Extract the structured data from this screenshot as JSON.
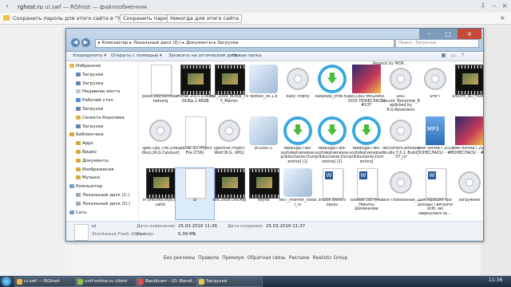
{
  "browser": {
    "url_host": "rghost.ru",
    "url_rest": "ui.swf — RGhost — файлообменник",
    "password_bar": {
      "text": "Сохранить пароль для этого сайта в \"Yandex\"?",
      "save_label": "Сохранить пароль",
      "never_label": "Никогда для этого сайта"
    }
  },
  "explorer": {
    "breadcrumb": "▸ Компьютер ▸ Локальный диск (D:) ▸ Документы ▸ Загрузки",
    "search_placeholder": "Поиск: Загрузки",
    "toolbar": {
      "organize": "Упорядочить ▾",
      "open_with": "Открыть с помощью ▾",
      "burn": "Записать на оптический диск",
      "new_folder": "Новая папка"
    },
    "tree": [
      {
        "label": "Избранное",
        "color": "#e8b84a",
        "indent": 0
      },
      {
        "label": "Загрузки",
        "color": "#5d86b3",
        "indent": 1
      },
      {
        "label": "Загрузки",
        "color": "#5d86b3",
        "indent": 1
      },
      {
        "label": "Недавние места",
        "color": "#b8c7d8",
        "indent": 1
      },
      {
        "label": "Рабочий стол",
        "color": "#4a8fd0",
        "indent": 1
      },
      {
        "label": "Загрузки",
        "color": "#5d86b3",
        "indent": 1
      },
      {
        "label": "Сюжета Королева",
        "color": "#d8b24a",
        "indent": 1
      },
      {
        "label": "Загрузки",
        "color": "#5d86b3",
        "indent": 1
      },
      {
        "label": "Библиотеки",
        "color": "#d7a842",
        "indent": 0
      },
      {
        "label": "Apps",
        "color": "#d7a842",
        "indent": 1
      },
      {
        "label": "Видео",
        "color": "#d7a842",
        "indent": 1
      },
      {
        "label": "Документы",
        "color": "#d7a842",
        "indent": 1
      },
      {
        "label": "Изображения",
        "color": "#d7a842",
        "indent": 1
      },
      {
        "label": "Музыка",
        "color": "#d7a842",
        "indent": 1
      },
      {
        "label": "Компьютер",
        "color": "#7aa0c8",
        "indent": 0
      },
      {
        "label": "Локальный диск (C:)",
        "color": "#9aa6b2",
        "indent": 1
      },
      {
        "label": "Локальный диск (D:)",
        "color": "#9aa6b2",
        "indent": 1
      },
      {
        "label": "Сеть",
        "color": "#7aa0c8",
        "indent": 0
      }
    ],
    "banner_text": "Repack by MOP...",
    "files": [
      {
        "name": "posle.dozhdichka.chetverg",
        "kind": "doc"
      },
      {
        "name": "Prizrak.2015.O.WEB-DLRip.1.46GB",
        "kind": "video"
      },
      {
        "name": "Put_2009_BDRip_745_Marren",
        "kind": "video"
      },
      {
        "name": "raidcall_v8.1.8",
        "kind": "app"
      },
      {
        "name": "Rally Trophy",
        "kind": "disc"
      },
      {
        "name": "Rasplata_[tfile.ru]",
        "kind": "dl"
      },
      {
        "name": "RECORD MEGAMIX 2015 ПОНЕСЛАСЬ! #137",
        "kind": "music"
      },
      {
        "name": "SAS-Secure_Tomorrow_Repacked by R.G.Revenants",
        "kind": "disc"
      },
      {
        "name": "SHIFT",
        "kind": "disc"
      },
      {
        "name": "Shturm_BD_HDRip",
        "kind": "video"
      },
      {
        "name": "Spec.Ops.The.Line.(Rus).[R.G.Catalyst]",
        "kind": "disc"
      },
      {
        "name": "Special 3D Project File (C56)",
        "kind": "doc"
      },
      {
        "name": "Spectraz Project Wolf [R.G. UPG]",
        "kind": "disc"
      },
      {
        "name": "st328971",
        "kind": "app"
      },
      {
        "name": "tabaluga-i-leo-vozhdestvenskoe-prikliuchenie-[torr entino] (1)",
        "kind": "dl"
      },
      {
        "name": "tabaluga-i-leo-vozhdestvenskoe-prikliuchenie-[torr entino] (2)",
        "kind": "dl"
      },
      {
        "name": "tabaluga-i-leo-vozhdestvenskoe-prikliuchenie-[torr entino]",
        "kind": "dl"
      },
      {
        "name": "TechSmithCamtasiaStudio.7.0.1_Build_57_ru",
        "kind": "disc"
      },
      {
        "name": "TRAP КАЧАЕТ 2015 ПОНЕСЛАСЬ! - #7",
        "kind": "mp3"
      },
      {
        "name": "TRAP КАЧАЕТ 2015 ПОНЕСЛАСЬ! - #11",
        "kind": "music"
      },
      {
        "name": "Tri.orechka.dlya.zolushki",
        "kind": "video"
      },
      {
        "name": "ui",
        "kind": "docsel"
      },
      {
        "name": "Volt.2008 DVDRip",
        "kind": "video"
      },
      {
        "name": "Voyna",
        "kind": "video"
      },
      {
        "name": "WoT_internet_install_ru",
        "kind": "app"
      },
      {
        "name": "zrazok blenkiv zayav",
        "kind": "word"
      },
      {
        "name": "Боевая система Никиты Шеменкова",
        "kind": "word"
      },
      {
        "name": "Все глобальные_2",
        "kind": "disc"
      },
      {
        "name": "Декларация про доходы і витрати осіб, які звернулися за ...",
        "kind": "word"
      },
      {
        "name": "загружено",
        "kind": "disc"
      }
    ],
    "details": {
      "name": "ui",
      "type": "Shockwave Flash Object",
      "modified_label": "Дата изменения:",
      "modified_value": "25.03.2016 11:36",
      "size_label": "Размер:",
      "size_value": "5,39 МБ",
      "created_label": "Дата создания:",
      "created_value": "25.03.2016 11:37"
    }
  },
  "footer": {
    "links": [
      "Без рекламы",
      "Правила",
      "Премиум",
      "Обратная связь",
      "Реклама",
      "Realistic Group"
    ]
  },
  "taskbar": {
    "items": [
      {
        "label": "ui.swf — RGhost",
        "color": "#e9b84a"
      },
      {
        "label": "unif-online.ru client",
        "color": "#8bc34a"
      },
      {
        "label": "Bandicam - (D: Bandi...",
        "color": "#e05050"
      },
      {
        "label": "Загрузки",
        "color": "#e8c35a"
      }
    ],
    "clock": "11:36"
  },
  "colors": {
    "accent": "#5d86b3",
    "close": "#c7493a",
    "download_green": "#4dbb3d"
  }
}
